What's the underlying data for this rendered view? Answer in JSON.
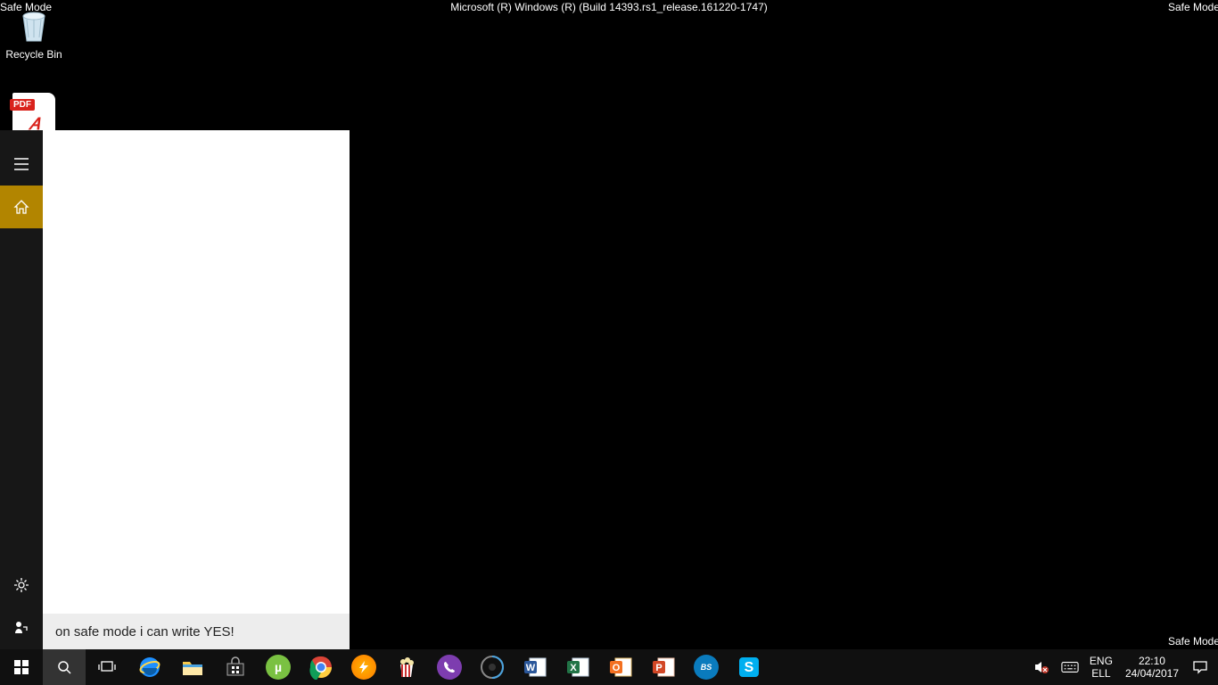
{
  "safe_mode_label": "Safe Mode",
  "build_string": "Microsoft (R) Windows (R) (Build 14393.rs1_release.161220-1747)",
  "desktop": {
    "recycle_bin_label": "Recycle Bin",
    "pdf_badge": "PDF"
  },
  "start_panel": {
    "search_text": "on safe mode i can write YES!"
  },
  "tray": {
    "lang_top": "ENG",
    "lang_bottom": "ELL",
    "time": "22:10",
    "date": "24/04/2017"
  },
  "taskbar_icons": [
    {
      "name": "internet-explorer-icon"
    },
    {
      "name": "file-explorer-icon"
    },
    {
      "name": "microsoft-store-icon"
    },
    {
      "name": "utorrent-icon"
    },
    {
      "name": "chrome-icon"
    },
    {
      "name": "daemon-tools-icon"
    },
    {
      "name": "popcorn-time-icon"
    },
    {
      "name": "viber-icon"
    },
    {
      "name": "media-app-icon"
    },
    {
      "name": "word-icon"
    },
    {
      "name": "excel-icon"
    },
    {
      "name": "outlook-icon"
    },
    {
      "name": "powerpoint-icon"
    },
    {
      "name": "bluestacks-icon"
    },
    {
      "name": "skype-icon"
    }
  ]
}
